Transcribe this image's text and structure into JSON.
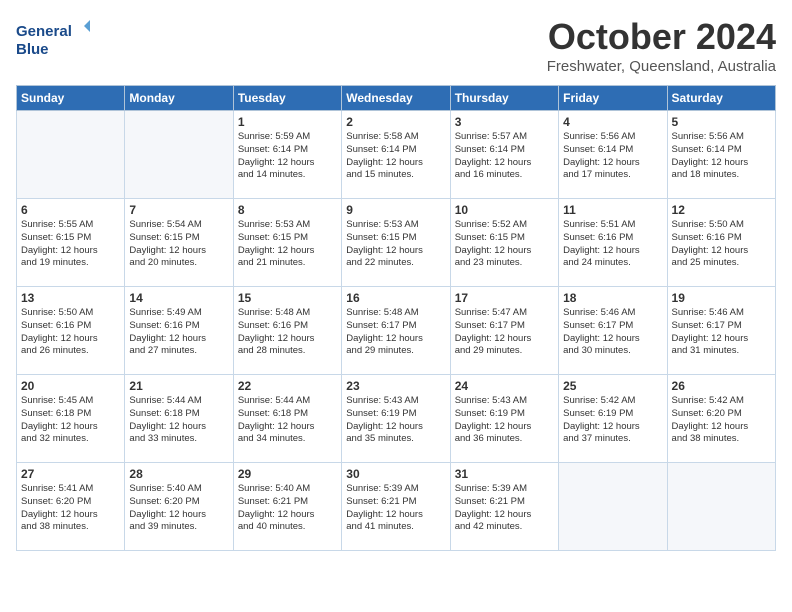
{
  "logo": {
    "line1": "General",
    "line2": "Blue"
  },
  "title": "October 2024",
  "subtitle": "Freshwater, Queensland, Australia",
  "weekdays": [
    "Sunday",
    "Monday",
    "Tuesday",
    "Wednesday",
    "Thursday",
    "Friday",
    "Saturday"
  ],
  "weeks": [
    [
      {
        "day": "",
        "info": ""
      },
      {
        "day": "",
        "info": ""
      },
      {
        "day": "1",
        "info": "Sunrise: 5:59 AM\nSunset: 6:14 PM\nDaylight: 12 hours\nand 14 minutes."
      },
      {
        "day": "2",
        "info": "Sunrise: 5:58 AM\nSunset: 6:14 PM\nDaylight: 12 hours\nand 15 minutes."
      },
      {
        "day": "3",
        "info": "Sunrise: 5:57 AM\nSunset: 6:14 PM\nDaylight: 12 hours\nand 16 minutes."
      },
      {
        "day": "4",
        "info": "Sunrise: 5:56 AM\nSunset: 6:14 PM\nDaylight: 12 hours\nand 17 minutes."
      },
      {
        "day": "5",
        "info": "Sunrise: 5:56 AM\nSunset: 6:14 PM\nDaylight: 12 hours\nand 18 minutes."
      }
    ],
    [
      {
        "day": "6",
        "info": "Sunrise: 5:55 AM\nSunset: 6:15 PM\nDaylight: 12 hours\nand 19 minutes."
      },
      {
        "day": "7",
        "info": "Sunrise: 5:54 AM\nSunset: 6:15 PM\nDaylight: 12 hours\nand 20 minutes."
      },
      {
        "day": "8",
        "info": "Sunrise: 5:53 AM\nSunset: 6:15 PM\nDaylight: 12 hours\nand 21 minutes."
      },
      {
        "day": "9",
        "info": "Sunrise: 5:53 AM\nSunset: 6:15 PM\nDaylight: 12 hours\nand 22 minutes."
      },
      {
        "day": "10",
        "info": "Sunrise: 5:52 AM\nSunset: 6:15 PM\nDaylight: 12 hours\nand 23 minutes."
      },
      {
        "day": "11",
        "info": "Sunrise: 5:51 AM\nSunset: 6:16 PM\nDaylight: 12 hours\nand 24 minutes."
      },
      {
        "day": "12",
        "info": "Sunrise: 5:50 AM\nSunset: 6:16 PM\nDaylight: 12 hours\nand 25 minutes."
      }
    ],
    [
      {
        "day": "13",
        "info": "Sunrise: 5:50 AM\nSunset: 6:16 PM\nDaylight: 12 hours\nand 26 minutes."
      },
      {
        "day": "14",
        "info": "Sunrise: 5:49 AM\nSunset: 6:16 PM\nDaylight: 12 hours\nand 27 minutes."
      },
      {
        "day": "15",
        "info": "Sunrise: 5:48 AM\nSunset: 6:16 PM\nDaylight: 12 hours\nand 28 minutes."
      },
      {
        "day": "16",
        "info": "Sunrise: 5:48 AM\nSunset: 6:17 PM\nDaylight: 12 hours\nand 29 minutes."
      },
      {
        "day": "17",
        "info": "Sunrise: 5:47 AM\nSunset: 6:17 PM\nDaylight: 12 hours\nand 29 minutes."
      },
      {
        "day": "18",
        "info": "Sunrise: 5:46 AM\nSunset: 6:17 PM\nDaylight: 12 hours\nand 30 minutes."
      },
      {
        "day": "19",
        "info": "Sunrise: 5:46 AM\nSunset: 6:17 PM\nDaylight: 12 hours\nand 31 minutes."
      }
    ],
    [
      {
        "day": "20",
        "info": "Sunrise: 5:45 AM\nSunset: 6:18 PM\nDaylight: 12 hours\nand 32 minutes."
      },
      {
        "day": "21",
        "info": "Sunrise: 5:44 AM\nSunset: 6:18 PM\nDaylight: 12 hours\nand 33 minutes."
      },
      {
        "day": "22",
        "info": "Sunrise: 5:44 AM\nSunset: 6:18 PM\nDaylight: 12 hours\nand 34 minutes."
      },
      {
        "day": "23",
        "info": "Sunrise: 5:43 AM\nSunset: 6:19 PM\nDaylight: 12 hours\nand 35 minutes."
      },
      {
        "day": "24",
        "info": "Sunrise: 5:43 AM\nSunset: 6:19 PM\nDaylight: 12 hours\nand 36 minutes."
      },
      {
        "day": "25",
        "info": "Sunrise: 5:42 AM\nSunset: 6:19 PM\nDaylight: 12 hours\nand 37 minutes."
      },
      {
        "day": "26",
        "info": "Sunrise: 5:42 AM\nSunset: 6:20 PM\nDaylight: 12 hours\nand 38 minutes."
      }
    ],
    [
      {
        "day": "27",
        "info": "Sunrise: 5:41 AM\nSunset: 6:20 PM\nDaylight: 12 hours\nand 38 minutes."
      },
      {
        "day": "28",
        "info": "Sunrise: 5:40 AM\nSunset: 6:20 PM\nDaylight: 12 hours\nand 39 minutes."
      },
      {
        "day": "29",
        "info": "Sunrise: 5:40 AM\nSunset: 6:21 PM\nDaylight: 12 hours\nand 40 minutes."
      },
      {
        "day": "30",
        "info": "Sunrise: 5:39 AM\nSunset: 6:21 PM\nDaylight: 12 hours\nand 41 minutes."
      },
      {
        "day": "31",
        "info": "Sunrise: 5:39 AM\nSunset: 6:21 PM\nDaylight: 12 hours\nand 42 minutes."
      },
      {
        "day": "",
        "info": ""
      },
      {
        "day": "",
        "info": ""
      }
    ]
  ]
}
